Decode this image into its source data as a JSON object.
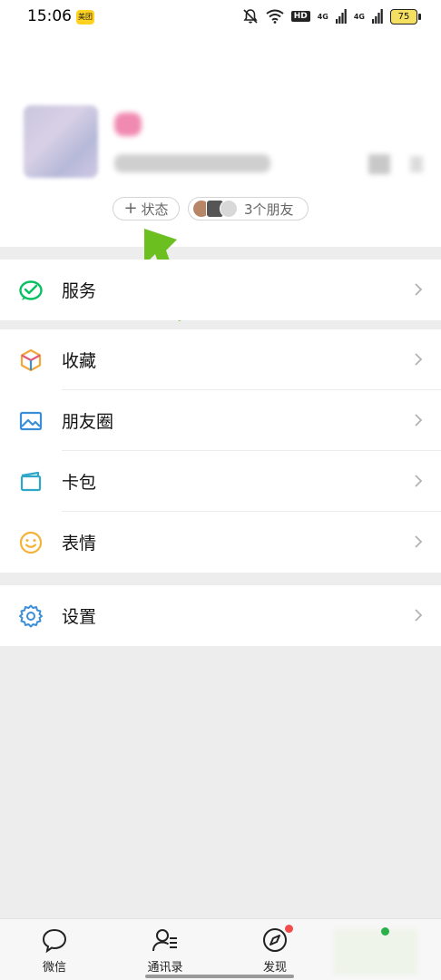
{
  "status_bar": {
    "time": "15:06",
    "app_badge": "美团",
    "hd": "HD",
    "net1": "4G",
    "net2": "4G",
    "battery": "75"
  },
  "profile": {
    "status_chip": {
      "plus": "+",
      "label": "状态"
    },
    "friends_chip": {
      "label": "3个朋友"
    }
  },
  "menu": {
    "group1": [
      {
        "label": "服务",
        "icon": "wechat-pay-icon",
        "color": "#07c160"
      }
    ],
    "group2": [
      {
        "label": "收藏",
        "icon": "cube-icon",
        "color": "#f2a93b"
      },
      {
        "label": "朋友圈",
        "icon": "image-icon",
        "color": "#3b8fd9"
      },
      {
        "label": "卡包",
        "icon": "card-wallet-icon",
        "color": "#2ea7c9"
      },
      {
        "label": "表情",
        "icon": "smiley-icon",
        "color": "#f5b335"
      }
    ],
    "group3": [
      {
        "label": "设置",
        "icon": "gear-icon",
        "color": "#3b8fd9"
      }
    ]
  },
  "tabs": [
    {
      "label": "微信",
      "icon": "chat-bubble-icon"
    },
    {
      "label": "通讯录",
      "icon": "contacts-icon"
    },
    {
      "label": "发现",
      "icon": "compass-icon",
      "badge": true
    }
  ],
  "colors": {
    "accent": "#07c160",
    "arrow": "#6bbf1f",
    "badge_red": "#f24b4b"
  }
}
